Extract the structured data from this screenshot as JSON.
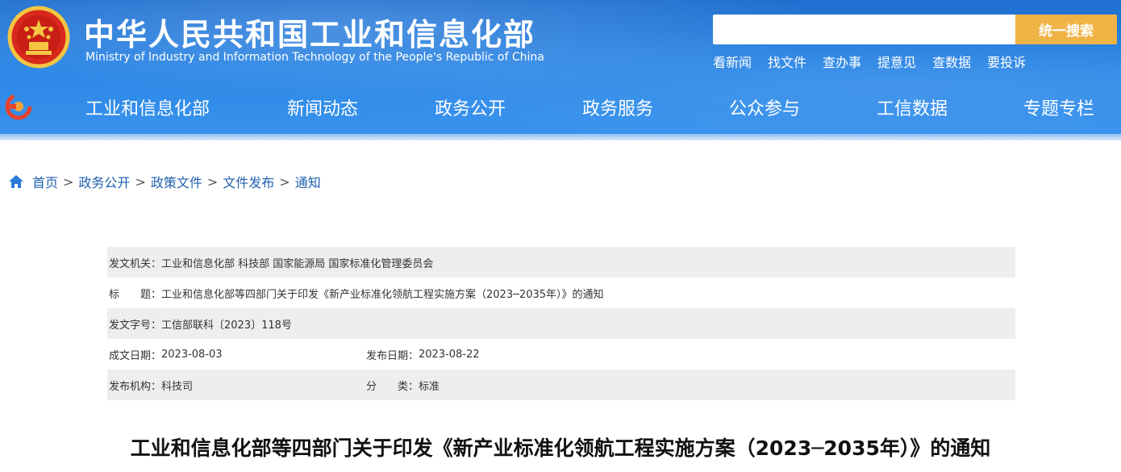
{
  "header": {
    "title_cn": "中华人民共和国工业和信息化部",
    "title_en": "Ministry of Industry and Information Technology of the People's Republic of China",
    "emblem_icon": "national-emblem-icon",
    "search": {
      "placeholder": "",
      "button_label": "统一搜索"
    },
    "quick_links": [
      "看新闻",
      "找文件",
      "查办事",
      "提意见",
      "查数据",
      "要投诉"
    ]
  },
  "nav": {
    "logo_icon": "miit-logo-icon",
    "items": [
      "工业和信息化部",
      "新闻动态",
      "政务公开",
      "政务服务",
      "公众参与",
      "工信数据",
      "专题专栏"
    ]
  },
  "breadcrumb": {
    "home_icon": "home-icon",
    "items": [
      "首页",
      "政务公开",
      "政策文件",
      "文件发布",
      "通知"
    ],
    "separator": ">"
  },
  "meta": {
    "issuer_label": "发文机关：",
    "issuer_value": "工业和信息化部 科技部 国家能源局 国家标准化管理委员会",
    "title_label": "标　　题：",
    "title_value": "工业和信息化部等四部门关于印发《新产业标准化领航工程实施方案（2023─2035年）》的通知",
    "doc_no_label": "发文字号：",
    "doc_no_value": "工信部联科〔2023〕118号",
    "created_label": "成文日期：",
    "created_value": "2023-08-03",
    "published_label": "发布日期：",
    "published_value": "2023-08-22",
    "org_label": "发布机构：",
    "org_value": "科技司",
    "category_label": "分　　类：",
    "category_value": "标准"
  },
  "document": {
    "title": "工业和信息化部等四部门关于印发《新产业标准化领航工程实施方案（2023─2035年）》的通知"
  },
  "colors": {
    "header_blue": "#2a86e6",
    "search_button": "#f0b345",
    "link_blue": "#1f5fae",
    "row_shade": "#eeeeee"
  }
}
